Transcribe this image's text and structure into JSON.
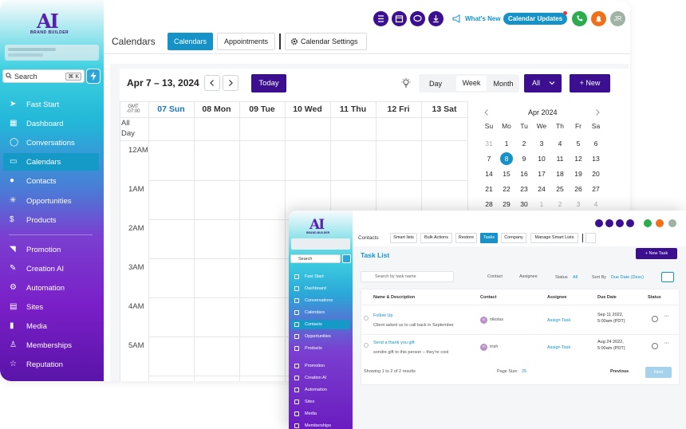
{
  "brand": {
    "logo_letters": "AI",
    "logo_text": "BRAND BUILDER"
  },
  "sidebar": {
    "search_label": "Search",
    "search_shortcut": "⌘ K",
    "items": [
      {
        "label": "Fast Start",
        "icon": "rocket-icon"
      },
      {
        "label": "Dashboard",
        "icon": "dashboard-icon"
      },
      {
        "label": "Conversations",
        "icon": "chat-icon"
      },
      {
        "label": "Calendars",
        "icon": "calendar-icon",
        "active": true
      },
      {
        "label": "Contacts",
        "icon": "contacts-icon"
      },
      {
        "label": "Opportunities",
        "icon": "opportunities-icon"
      },
      {
        "label": "Products",
        "icon": "dollar-icon"
      },
      {
        "label": "Promotion",
        "icon": "promotion-icon"
      },
      {
        "label": "Creation AI",
        "icon": "edit-icon"
      },
      {
        "label": "Automation",
        "icon": "gear-icon"
      },
      {
        "label": "Sites",
        "icon": "sites-icon"
      },
      {
        "label": "Media",
        "icon": "media-icon"
      },
      {
        "label": "Memberships",
        "icon": "membership-icon"
      },
      {
        "label": "Reputation",
        "icon": "star-icon"
      }
    ]
  },
  "topbar": {
    "whats_new": "What's New",
    "calendar_updates": "Calendar Updates",
    "avatar_initials": "JR",
    "colors": {
      "purple": "#3b0f8f",
      "blue": "#1593c9",
      "green": "#2dab4f",
      "orange": "#f0701a"
    }
  },
  "header": {
    "title": "Calendars",
    "tabs": [
      "Calendars",
      "Appointments"
    ],
    "settings": "Calendar Settings"
  },
  "calendar": {
    "range": "Apr 7 – 13, 2024",
    "today": "Today",
    "views": [
      "Day",
      "Week",
      "Month"
    ],
    "active_view": "Week",
    "filter": "All",
    "new": "+ New",
    "tz_line1": "GMT",
    "tz_line2": "-07:00",
    "all_day": "All Day",
    "days": [
      "07 Sun",
      "08 Mon",
      "09 Tue",
      "10 Wed",
      "11 Thu",
      "12 Fri",
      "13 Sat"
    ],
    "times": [
      "12AM",
      "1AM",
      "2AM",
      "3AM",
      "4AM",
      "5AM"
    ]
  },
  "mini_calendar": {
    "month": "Apr 2024",
    "dow": [
      "Su",
      "Mo",
      "Tu",
      "We",
      "Th",
      "Fr",
      "Sa"
    ],
    "weeks": [
      [
        "31",
        "1",
        "2",
        "3",
        "4",
        "5",
        "6"
      ],
      [
        "7",
        "8",
        "9",
        "10",
        "11",
        "12",
        "13"
      ],
      [
        "14",
        "15",
        "16",
        "17",
        "18",
        "19",
        "20"
      ],
      [
        "21",
        "22",
        "23",
        "24",
        "25",
        "26",
        "27"
      ],
      [
        "28",
        "29",
        "30",
        "1",
        "2",
        "3",
        "4"
      ]
    ],
    "selected": "8"
  },
  "overlay": {
    "tabs": [
      "Contacts",
      "Smart lists",
      "Bulk Actions",
      "Restore",
      "Tasks",
      "Company",
      "Manage Smart Lists"
    ],
    "active_tab": "Tasks",
    "title": "Task List",
    "new_task": "+ New Task",
    "search_placeholder": "Search by task name",
    "filters": [
      "Contact",
      "Assignee"
    ],
    "status_label": "Status",
    "status_value": "All",
    "sort_label": "Sort By",
    "sort_value": "Due Date (Desc)",
    "columns": [
      "Name & Description",
      "Contact",
      "Assignee",
      "Due Date",
      "Status"
    ],
    "rows": [
      {
        "name": "Follow Up",
        "desc": "Client asked us to call back in September",
        "contact": "nikolas",
        "initials": "NI",
        "assignee": "Assign Task",
        "due1": "Sep 11 2022,",
        "due2": "5:00am (PDT)"
      },
      {
        "name": "Send a thank you gift",
        "desc": "sondre gift to this person – they're cool",
        "contact": "trish",
        "initials": "TR",
        "assignee": "Assign Task",
        "due1": "Aug 24 2022,",
        "due2": "5:00am (PDT)"
      }
    ],
    "showing": "Showing 1 to 2 of 2 results",
    "page_size_label": "Page Size:",
    "page_size": "25",
    "previous": "Previous",
    "next": "Next",
    "sidebar_search": "Search",
    "sidebar_items": [
      "Fast Start",
      "Dashboard",
      "Conversations",
      "Calendars",
      "Contacts",
      "Opportunities",
      "Products",
      "Promotion",
      "Creation AI",
      "Automation",
      "Sites",
      "Media",
      "Memberships"
    ],
    "sidebar_active": "Contacts"
  }
}
